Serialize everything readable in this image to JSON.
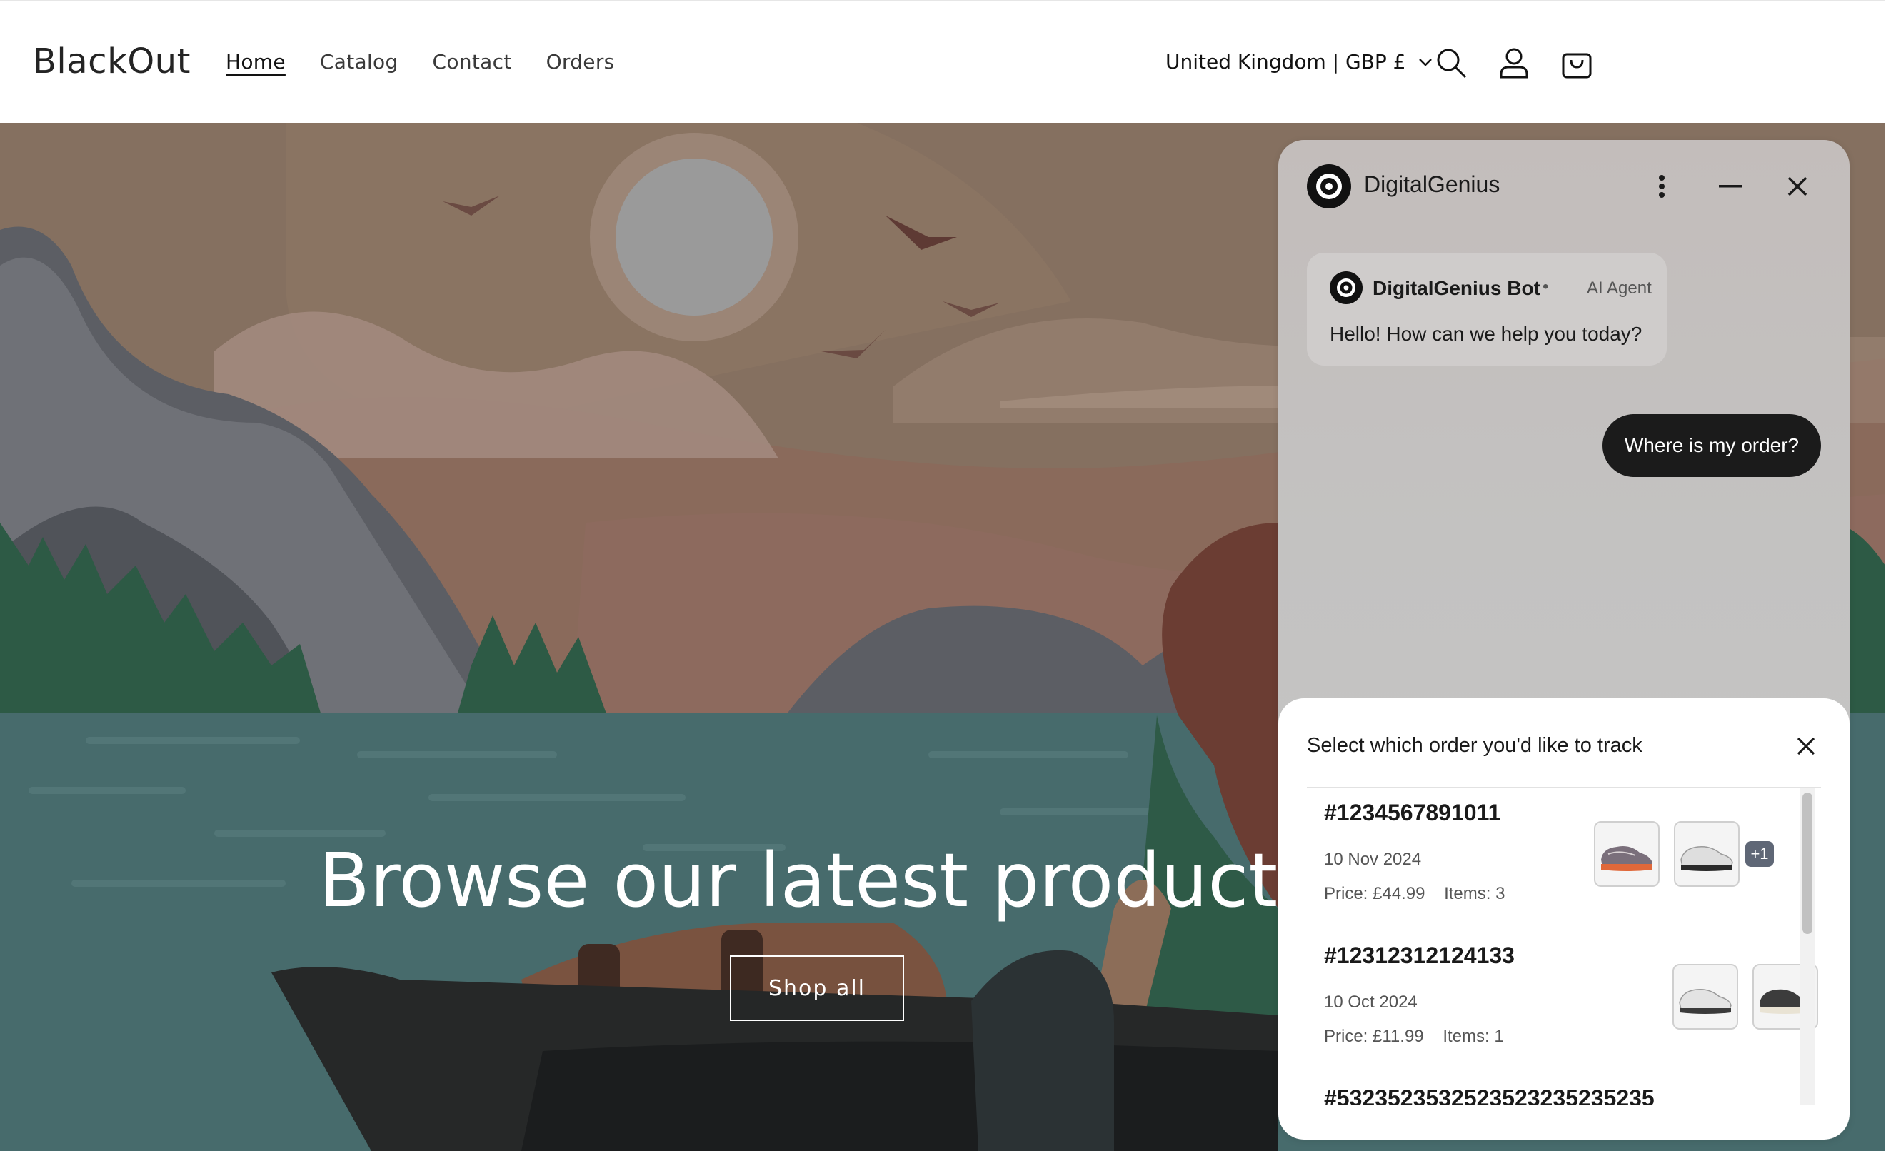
{
  "header": {
    "logo": "BlackOut",
    "nav": [
      "Home",
      "Catalog",
      "Contact",
      "Orders"
    ],
    "locale": "United Kingdom | GBP £",
    "icons": [
      "search-icon",
      "account-icon",
      "cart-icon"
    ]
  },
  "hero": {
    "title": "Browse our latest products",
    "cta": "Shop all"
  },
  "chat": {
    "title": "DigitalGenius",
    "bot_name": "DigitalGenius Bot",
    "bot_separator": "•",
    "bot_role": "AI Agent",
    "bot_message": "Hello! How can we help you today?",
    "user_message": "Where is my order?",
    "sheet": {
      "title": "Select which order you'd like to track",
      "orders": [
        {
          "id": "#1234567891011",
          "date": "10 Nov 2024",
          "price": "Price: £44.99",
          "items": "Items: 3",
          "thumbs": [
            "orange-sneaker",
            "white-sneaker"
          ],
          "more": "+1"
        },
        {
          "id": "#12312312124133",
          "date": "10 Oct 2024",
          "price": "Price: £11.99",
          "items": "Items: 1",
          "thumbs": [
            "white-sneaker",
            "dark-sneaker"
          ],
          "more": ""
        },
        {
          "id": "#5323523532523523235235235",
          "date": "",
          "price": "",
          "items": "",
          "thumbs": [],
          "more": ""
        }
      ]
    }
  },
  "colors": {
    "chat_user_bubble": "#1b1b1b",
    "more_badge": "#5f6776",
    "hero_water": "#476b6c",
    "hero_sky": "#8a7261"
  }
}
